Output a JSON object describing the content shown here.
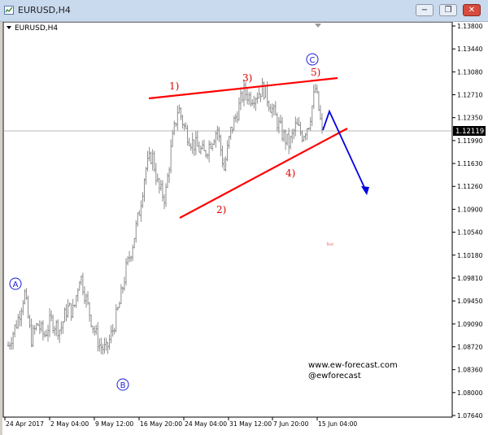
{
  "window": {
    "title": "EURUSD,H4",
    "chart_label": "EURUSD,H4",
    "buttons": [
      {
        "name": "minimize-button",
        "icon": "minimize-icon",
        "glyph": "−"
      },
      {
        "name": "restore-button",
        "icon": "restore-icon",
        "glyph": "❐"
      },
      {
        "name": "close-button",
        "icon": "close-icon",
        "glyph": "✕"
      }
    ]
  },
  "price_axis": {
    "labels": [
      "1.13800",
      "1.13440",
      "1.13080",
      "1.12710",
      "1.12350",
      "1.11990",
      "1.11630",
      "1.11260",
      "1.10900",
      "1.10540",
      "1.10180",
      "1.09810",
      "1.09450",
      "1.09090",
      "1.08720",
      "1.08360",
      "1.08000",
      "1.07640"
    ],
    "current_price": "1.12119",
    "current_color": "#000000"
  },
  "time_axis": {
    "labels": [
      "24 Apr 2017",
      "2 May 04:00",
      "9 May 12:00",
      "16 May 20:00",
      "24 May 04:00",
      "31 May 12:00",
      "7 Jun 20:00",
      "15 Jun 04:00"
    ]
  },
  "wave_labels": {
    "A": "A",
    "B": "B",
    "C": "C",
    "w1": "1)",
    "w2": "2)",
    "w3": "3)",
    "w4": "4)",
    "w5": "5)",
    "text_mark": "Text"
  },
  "watermark": {
    "site": "www.ew-forecast.com",
    "handle": "@ewforecast"
  },
  "colors": {
    "bars": "#8c8c8c",
    "trendline": "#ff0000",
    "wave_red": "#e00000",
    "wave_blue": "#1c1cd8",
    "projection": "#0000e0",
    "grid_line": "#a0a0a0"
  },
  "chart_data": {
    "type": "ohlc",
    "symbol": "EURUSD",
    "timeframe": "H4",
    "x": [
      "24 Apr 2017",
      "2 May 04:00",
      "9 May 12:00",
      "16 May 20:00",
      "24 May 04:00",
      "31 May 12:00",
      "7 Jun 20:00",
      "15 Jun 04:00"
    ],
    "ylim": [
      1.0764,
      1.138
    ],
    "current": 1.12119,
    "close_path": [
      [
        0,
        1.087
      ],
      [
        3,
        1.0912
      ],
      [
        5,
        1.0955
      ],
      [
        7,
        1.088
      ],
      [
        9,
        1.0905
      ],
      [
        11,
        1.0885
      ],
      [
        13,
        1.091
      ],
      [
        16,
        1.0895
      ],
      [
        18,
        1.093
      ],
      [
        20,
        1.0925
      ],
      [
        22,
        1.0985
      ],
      [
        24,
        1.094
      ],
      [
        26,
        1.09
      ],
      [
        28,
        1.087
      ],
      [
        30,
        1.0862
      ],
      [
        32,
        1.0895
      ],
      [
        34,
        1.0935
      ],
      [
        36,
        1.099
      ],
      [
        38,
        1.103
      ],
      [
        40,
        1.108
      ],
      [
        42,
        1.115
      ],
      [
        44,
        1.1175
      ],
      [
        46,
        1.112
      ],
      [
        48,
        1.1105
      ],
      [
        50,
        1.119
      ],
      [
        52,
        1.125
      ],
      [
        54,
        1.1215
      ],
      [
        56,
        1.1195
      ],
      [
        58,
        1.1185
      ],
      [
        60,
        1.1175
      ],
      [
        62,
        1.1195
      ],
      [
        64,
        1.1215
      ],
      [
        66,
        1.115
      ],
      [
        68,
        1.121
      ],
      [
        70,
        1.124
      ],
      [
        72,
        1.1275
      ],
      [
        74,
        1.1265
      ],
      [
        76,
        1.127
      ],
      [
        78,
        1.128
      ],
      [
        80,
        1.1255
      ],
      [
        82,
        1.123
      ],
      [
        84,
        1.1205
      ],
      [
        86,
        1.119
      ],
      [
        88,
        1.122
      ],
      [
        90,
        1.1205
      ],
      [
        92,
        1.1225
      ],
      [
        94,
        1.128
      ],
      [
        96,
        1.121
      ]
    ],
    "wave_points": {
      "A": 1.096,
      "B": 1.0836,
      "1": 1.1275,
      "2": 1.1143,
      "3": 1.129,
      "4": 1.118,
      "5": 1.129,
      "C": 1.13
    },
    "upper_trendline": [
      [
        1.127
      ],
      [
        1.1302
      ]
    ],
    "lower_trendline": [
      [
        1.108
      ],
      [
        1.1205
      ]
    ],
    "projection": [
      1.1212,
      1.125,
      1.1125
    ]
  }
}
